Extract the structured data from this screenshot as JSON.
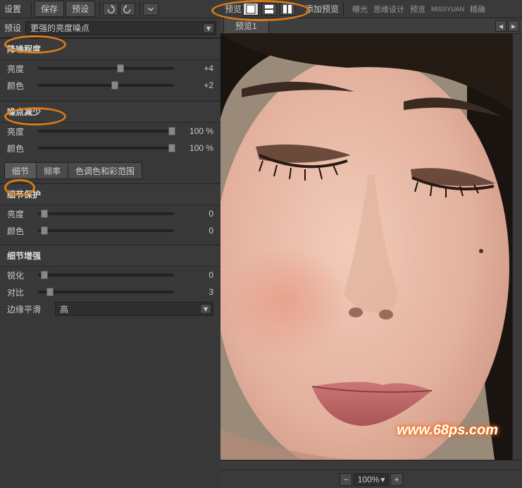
{
  "header": {
    "settings": "设置",
    "save": "保存",
    "preset": "预设"
  },
  "presetRow": {
    "label": "预设",
    "value": "更强的亮度噪点"
  },
  "sections": {
    "noiseLevel": {
      "title": "降噪程度",
      "brightness": {
        "label": "亮度",
        "value": "+4",
        "pos": 58
      },
      "color": {
        "label": "颜色",
        "value": "+2",
        "pos": 54
      }
    },
    "noiseReduce": {
      "title": "噪点减少",
      "brightness": {
        "label": "亮度",
        "value": "100 %",
        "pos": 96
      },
      "color": {
        "label": "颜色",
        "value": "100 %",
        "pos": 96
      }
    },
    "tabs": {
      "detail": "细节",
      "freq": "频率",
      "tone": "色调色和彩范围"
    },
    "detailProtect": {
      "title": "细节保护",
      "brightness": {
        "label": "亮度",
        "value": "0",
        "pos": 2
      },
      "color": {
        "label": "颜色",
        "value": "0",
        "pos": 2
      }
    },
    "detailEnhance": {
      "title": "细节增强",
      "sharpen": {
        "label": "锐化",
        "value": "0",
        "pos": 2
      },
      "contrast": {
        "label": "对比",
        "value": "3",
        "pos": 6
      },
      "edge": {
        "label": "边缘平滑",
        "value": "高"
      }
    }
  },
  "rightTop": {
    "preview": "预览",
    "addPreview": "添加预览",
    "exposure": "曝光",
    "text1": "思缘设计",
    "text2": "预览",
    "miss": "MISSYUAN",
    "accurate": "精确"
  },
  "previewTab": "预览1",
  "zoom": "100%",
  "watermark": "www.68ps.com"
}
